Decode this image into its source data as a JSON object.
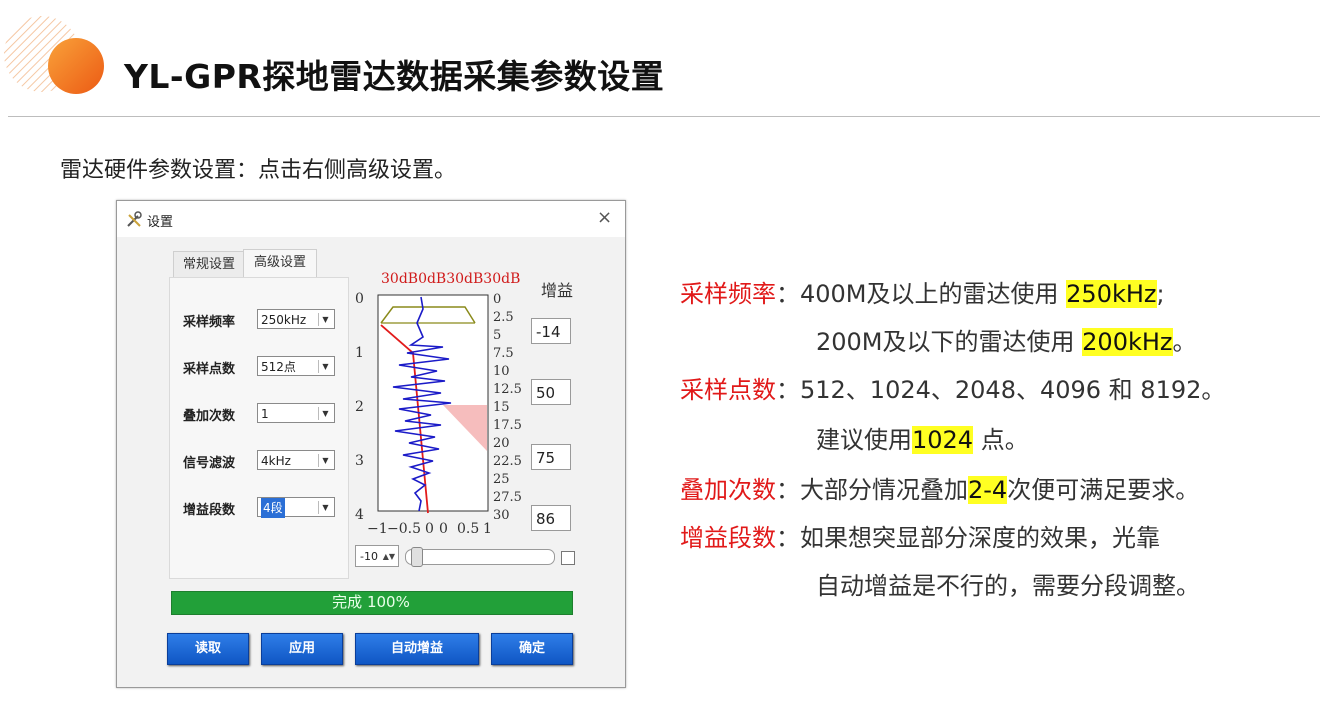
{
  "title": "YL-GPR探地雷达数据采集参数设置",
  "subtitle": "雷达硬件参数设置：点击右侧高级设置。",
  "dialog": {
    "title": "设置",
    "close": "×",
    "tabs": [
      "常规设置",
      "高级设置"
    ],
    "params": [
      {
        "label": "采样频率",
        "value": "250kHz"
      },
      {
        "label": "采样点数",
        "value": "512点"
      },
      {
        "label": "叠加次数",
        "value": "1"
      },
      {
        "label": "信号滤波",
        "value": "4kHz"
      },
      {
        "label": "增益段数",
        "value": "4段"
      }
    ],
    "gain_title": "增益",
    "gain_values": [
      "-14",
      "50",
      "75",
      "86"
    ],
    "chart_top_labels": "30dB0dB30dB30dB",
    "left_axis": [
      "0",
      "1",
      "2",
      "3",
      "4"
    ],
    "right_axis": [
      "0",
      "2.5",
      "5",
      "7.5",
      "10",
      "12.5",
      "15",
      "17.5",
      "20",
      "22.5",
      "25",
      "27.5",
      "30"
    ],
    "bottom_axis": [
      "−1",
      "−0.5",
      "0",
      "0",
      "0.5",
      "1"
    ],
    "spin_value": "-10",
    "progress_text": "完成 100%",
    "buttons": [
      "读取",
      "应用",
      "自动增益",
      "确定"
    ]
  },
  "notes": {
    "sampling_freq": {
      "label": "采样频率",
      "line1_pre": "400M及以上的雷达使用 ",
      "line1_hl": "250kHz",
      "line1_post": ";",
      "line2_pre": "200M及以下的雷达使用 ",
      "line2_hl": "200kHz",
      "line2_post": "。"
    },
    "sample_points": {
      "label": "采样点数",
      "line1": "512、1024、2048、4096 和 8192。",
      "line2_pre": "建议使用",
      "line2_hl": "1024",
      "line2_post": " 点。"
    },
    "stack": {
      "label": "叠加次数",
      "pre": "大部分情况叠加",
      "hl": "2-4",
      "post": "次便可满足要求。"
    },
    "gain_segments": {
      "label": "增益段数",
      "line1": "如果想突显部分深度的效果，光靠",
      "line2": "自动增益是不行的，需要分段调整。"
    },
    "colon": "："
  },
  "colors": {
    "accent_orange": "#f07a1a",
    "label_red": "#e11919",
    "highlight": "#ffff22",
    "progress_green": "#22a039",
    "button_blue": "#1a66d6"
  }
}
